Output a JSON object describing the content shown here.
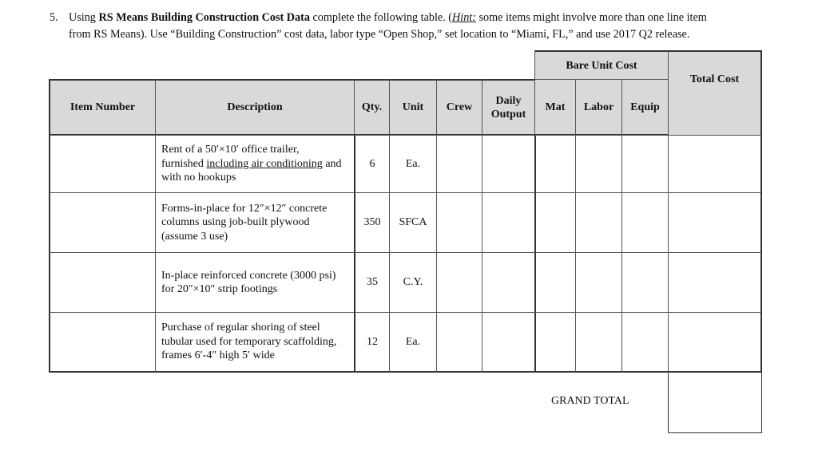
{
  "question": {
    "number": "5.",
    "line1_prefix": "Using ",
    "line1_bold": "RS Means Building Construction Cost Data",
    "line1_mid": " complete the following table. (",
    "line1_hint": "Hint:",
    "line1_suffix": " some items might involve more than one line item",
    "line2": "from RS Means). Use “Building Construction” cost data, labor type “Open Shop,” set location to “Miami, FL,” and use 2017 Q2 release."
  },
  "table": {
    "group_header": "Bare Unit Cost",
    "headers": {
      "item_number": "Item Number",
      "description": "Description",
      "qty": "Qty.",
      "unit": "Unit",
      "crew": "Crew",
      "daily_output": "Daily Output",
      "mat": "Mat",
      "labor": "Labor",
      "equip": "Equip",
      "total_cost": "Total Cost"
    },
    "rows": [
      {
        "item_number": "",
        "description_pre": "Rent of a 50′×10′ office trailer, furnished ",
        "description_underlined": "including air conditioning",
        "description_post": " and with no hookups",
        "qty": "6",
        "unit": "Ea.",
        "crew": "",
        "daily_output": "",
        "mat": "",
        "labor": "",
        "equip": "",
        "total_cost": ""
      },
      {
        "item_number": "",
        "description": "Forms-in-place for 12″×12″ concrete columns using job-built plywood (assume 3 use)",
        "qty": "350",
        "unit": "SFCA",
        "crew": "",
        "daily_output": "",
        "mat": "",
        "labor": "",
        "equip": "",
        "total_cost": ""
      },
      {
        "item_number": "",
        "description": "In-place reinforced concrete (3000 psi) for 20″×10″ strip footings",
        "qty": "35",
        "unit": "C.Y.",
        "crew": "",
        "daily_output": "",
        "mat": "",
        "labor": "",
        "equip": "",
        "total_cost": ""
      },
      {
        "item_number": "",
        "description": "Purchase of regular shoring of steel tubular used for temporary scaffolding, frames 6′-4″ high 5′ wide",
        "qty": "12",
        "unit": "Ea.",
        "crew": "",
        "daily_output": "",
        "mat": "",
        "labor": "",
        "equip": "",
        "total_cost": ""
      }
    ],
    "grand_total_label": "GRAND TOTAL",
    "grand_total_value": ""
  }
}
